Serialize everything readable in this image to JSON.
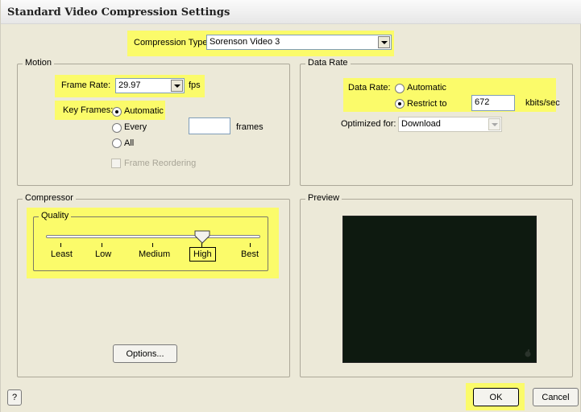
{
  "window": {
    "title": "Standard Video Compression Settings"
  },
  "compression": {
    "label": "Compression Type:",
    "value": "Sorenson Video 3"
  },
  "motion": {
    "group_label": "Motion",
    "frame_rate_label": "Frame Rate:",
    "frame_rate_value": "29.97",
    "fps_label": "fps",
    "key_frames_label": "Key Frames:",
    "key_options": [
      "Automatic",
      "Every",
      "All"
    ],
    "frames_value": "",
    "frames_label": "frames",
    "reorder_label": "Frame Reordering"
  },
  "data_rate": {
    "group_label": "Data Rate",
    "label": "Data Rate:",
    "automatic_label": "Automatic",
    "restrict_label": "Restrict to",
    "restrict_value": "672",
    "unit_label": "kbits/sec",
    "optimized_label": "Optimized for:",
    "optimized_value": "Download"
  },
  "compressor": {
    "group_label": "Compressor",
    "quality_label": "Quality",
    "levels": [
      "Least",
      "Low",
      "Medium",
      "High",
      "Best"
    ],
    "selected_level": "High",
    "options_label": "Options..."
  },
  "preview": {
    "group_label": "Preview"
  },
  "footer": {
    "help_label": "?",
    "ok_label": "OK",
    "cancel_label": "Cancel"
  },
  "colors": {
    "highlight": "#fbfb6a",
    "dialog_bg": "#ece9d8",
    "preview_bg": "#0e1a10"
  }
}
